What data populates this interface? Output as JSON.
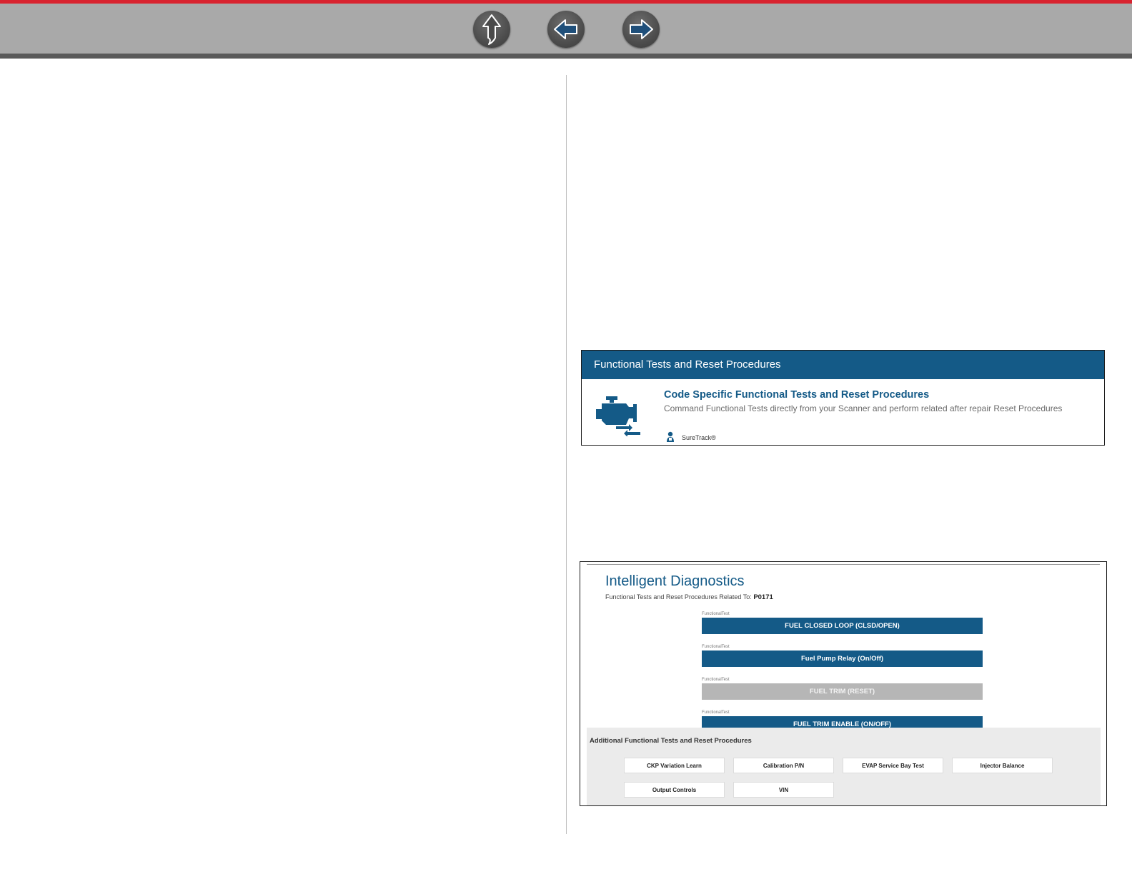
{
  "nav": {
    "up": "up-arrow-icon",
    "back": "left-arrow-icon",
    "forward": "right-arrow-icon"
  },
  "functional_tests_card": {
    "header": "Functional Tests and Reset Procedures",
    "title": "Code Specific Functional Tests and Reset Procedures",
    "description": "Command Functional Tests directly from your Scanner and perform related after repair Reset Procedures",
    "brand": "SureTrack®"
  },
  "intelligent_diagnostics": {
    "title": "Intelligent Diagnostics",
    "subtitle_prefix": "Functional Tests and Reset Procedures Related To:",
    "code": "P0171",
    "tests": [
      {
        "label": "FunctionalTest",
        "name": "FUEL CLOSED LOOP (CLSD/OPEN)",
        "enabled": true
      },
      {
        "label": "FunctionalTest",
        "name": "Fuel Pump Relay (On/Off)",
        "enabled": true
      },
      {
        "label": "FunctionalTest",
        "name": "FUEL TRIM (RESET)",
        "enabled": false
      },
      {
        "label": "FunctionalTest",
        "name": "FUEL TRIM ENABLE (ON/OFF)",
        "enabled": true
      }
    ],
    "additional_title": "Additional Functional Tests and Reset Procedures",
    "additional": [
      "CKP Variation Learn",
      "Calibration P/N",
      "EVAP Service Bay Test",
      "Injector Balance",
      "Output Controls",
      "VIN"
    ]
  },
  "colors": {
    "accent_blue": "#145a87",
    "top_red": "#d8232f",
    "bar_gray": "#a9a9a9"
  }
}
